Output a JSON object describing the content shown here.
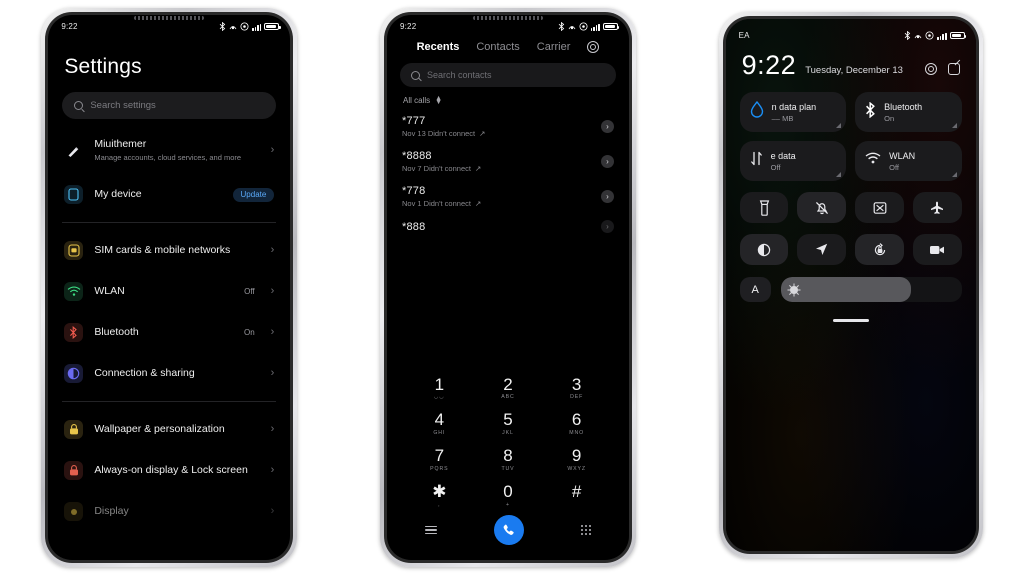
{
  "phone1": {
    "status": {
      "time": "9:22",
      "icons": [
        "bluetooth-icon",
        "nfc-icon",
        "dnd-icon",
        "signal-bars-icon",
        "battery-icon"
      ]
    },
    "title": "Settings",
    "search": {
      "placeholder": "Search settings",
      "icon": "search-icon"
    },
    "items": [
      {
        "title": "Miuithemer",
        "sub": "Manage accounts, cloud services, and more",
        "value": "",
        "icon": "account-icon",
        "icon_class": "ic-miui",
        "glyph": "🖊",
        "chevron": "›",
        "badge": ""
      },
      {
        "title": "My device",
        "sub": "",
        "value": "",
        "icon": "device-icon",
        "icon_class": "ic-device",
        "glyph": "▯",
        "chevron": "",
        "badge": "Update"
      },
      {
        "title": "SIM cards & mobile networks",
        "sub": "",
        "value": "",
        "icon": "sim-card-icon",
        "icon_class": "ic-sim",
        "glyph": "▣",
        "chevron": "›",
        "badge": ""
      },
      {
        "title": "WLAN",
        "sub": "",
        "value": "Off",
        "icon": "wifi-icon",
        "icon_class": "ic-wlan",
        "glyph": "▲",
        "chevron": "›",
        "badge": ""
      },
      {
        "title": "Bluetooth",
        "sub": "",
        "value": "On",
        "icon": "bluetooth-icon",
        "icon_class": "ic-bt",
        "glyph": "✦",
        "chevron": "›",
        "badge": ""
      },
      {
        "title": "Connection & sharing",
        "sub": "",
        "value": "",
        "icon": "connection-sharing-icon",
        "icon_class": "ic-conn",
        "glyph": "◑",
        "chevron": "›",
        "badge": ""
      },
      {
        "title": "Wallpaper & personalization",
        "sub": "",
        "value": "",
        "icon": "wallpaper-icon",
        "icon_class": "ic-wall",
        "glyph": "▦",
        "chevron": "›",
        "badge": ""
      },
      {
        "title": "Always-on display & Lock screen",
        "sub": "",
        "value": "",
        "icon": "lock-screen-icon",
        "icon_class": "ic-aod",
        "glyph": "▣",
        "chevron": "›",
        "badge": ""
      },
      {
        "title": "Display",
        "sub": "",
        "value": "",
        "icon": "display-icon",
        "icon_class": "ic-disp",
        "glyph": "☀",
        "chevron": "›",
        "badge": ""
      }
    ]
  },
  "phone2": {
    "status": {
      "time": "9:22"
    },
    "tabs": [
      {
        "label": "Recents",
        "active": true
      },
      {
        "label": "Contacts",
        "active": false
      },
      {
        "label": "Carrier",
        "active": false
      }
    ],
    "settings_icon": "gear-icon",
    "search": {
      "placeholder": "Search contacts",
      "icon": "search-icon"
    },
    "filter": {
      "label": "All calls",
      "icon": "sort-updown-icon"
    },
    "calls": [
      {
        "number": "*777",
        "meta": "Nov 13 Didn't connect",
        "direction": "↗",
        "action_icon": "chevron-right-icon"
      },
      {
        "number": "*8888",
        "meta": "Nov 7 Didn't connect",
        "direction": "↗",
        "action_icon": "chevron-right-icon"
      },
      {
        "number": "*778",
        "meta": "Nov 1 Didn't connect",
        "direction": "↗",
        "action_icon": "chevron-right-icon"
      },
      {
        "number": "*888",
        "meta": "",
        "direction": "",
        "action_icon": "chevron-right-icon"
      }
    ],
    "keypad": [
      {
        "digit": "1",
        "letters": "◡◡"
      },
      {
        "digit": "2",
        "letters": "ABC"
      },
      {
        "digit": "3",
        "letters": "DEF"
      },
      {
        "digit": "4",
        "letters": "GHI"
      },
      {
        "digit": "5",
        "letters": "JKL"
      },
      {
        "digit": "6",
        "letters": "MNO"
      },
      {
        "digit": "7",
        "letters": "PQRS"
      },
      {
        "digit": "8",
        "letters": "TUV"
      },
      {
        "digit": "9",
        "letters": "WXYZ"
      },
      {
        "digit": "✱",
        "letters": ","
      },
      {
        "digit": "0",
        "letters": "+"
      },
      {
        "digit": "#",
        "letters": ""
      }
    ],
    "actions": {
      "menu_icon": "hamburger-menu-icon",
      "call_icon": "call-icon",
      "keypad_icon": "keypad-icon",
      "call_button_color": "#1a7bf0"
    }
  },
  "phone3": {
    "status": {
      "carrier": "EA",
      "icons": [
        "bluetooth-icon",
        "nfc-icon",
        "dnd-icon",
        "signal-bars-icon",
        "battery-icon"
      ]
    },
    "clock": {
      "time": "9:22",
      "date": "Tuesday, December 13"
    },
    "header_icons": [
      {
        "name": "camera-shortcut-icon"
      },
      {
        "name": "edit-icon"
      }
    ],
    "big_tiles": [
      {
        "title": "n data plan",
        "sub": "–– MB",
        "icon": "data-plan-drop-icon",
        "on": false
      },
      {
        "title": "Bluetooth",
        "sub": "On",
        "icon": "bluetooth-icon",
        "on": true
      },
      {
        "title": "e data",
        "sub": "Off",
        "icon": "mobile-data-icon",
        "on": false
      },
      {
        "title": "WLAN",
        "sub": "Off",
        "icon": "wifi-icon",
        "on": false
      }
    ],
    "small_tiles": [
      {
        "icon": "flashlight-icon",
        "on": false
      },
      {
        "icon": "silent-bell-icon",
        "on": true
      },
      {
        "icon": "screenshot-icon",
        "on": false
      },
      {
        "icon": "airplane-mode-icon",
        "on": false
      },
      {
        "icon": "dark-mode-icon",
        "on": true
      },
      {
        "icon": "location-icon",
        "on": false
      },
      {
        "icon": "rotation-lock-icon",
        "on": true
      },
      {
        "icon": "screen-record-icon",
        "on": false
      }
    ],
    "brightness": {
      "auto_label": "A",
      "icon": "brightness-sun-icon",
      "level_percent": 72
    },
    "home_indicator": true
  }
}
